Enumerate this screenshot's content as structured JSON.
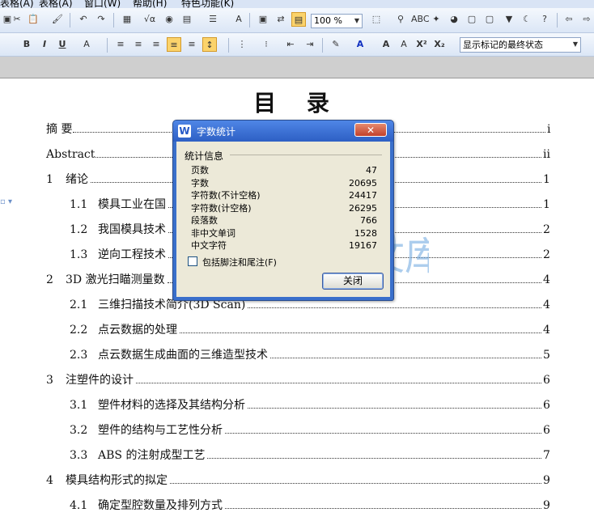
{
  "menu": [
    "表格(A)",
    "窗口(W)",
    "帮助(H)",
    "特色功能(K)"
  ],
  "toolbar1": {
    "zoom": "100 %",
    "icons": [
      "paste-icon",
      "format-painter-icon",
      "undo-icon",
      "redo-icon",
      "table-icon",
      "formula-icon",
      "chart-icon",
      "columns-icon",
      "find-icon",
      "spellcheck-icon",
      "help-icon",
      "back-icon"
    ]
  },
  "toolbar2": {
    "bold": "B",
    "italic": "I",
    "underline": "U",
    "markup_state": "显示标记的最终状态"
  },
  "document": {
    "title": "目 录",
    "entries": [
      {
        "num": "摘    要",
        "text": "",
        "page": "i",
        "level": 0
      },
      {
        "num": "Abstract",
        "text": "",
        "page": "ii",
        "level": 0
      },
      {
        "num": "1",
        "text": "绪论",
        "page": "1",
        "level": 1
      },
      {
        "num": "1.1",
        "text": "模具工业在国",
        "page": "1",
        "level": 2
      },
      {
        "num": "1.2",
        "text": "我国模具技术",
        "page": "2",
        "level": 2
      },
      {
        "num": "1.3",
        "text": "逆向工程技术",
        "page": "2",
        "level": 2
      },
      {
        "num": "2",
        "text": "3D 激光扫瞄测量数",
        "page": "4",
        "level": 1
      },
      {
        "num": "2.1",
        "text": "三维扫描技术简介(3D Scan)",
        "page": "4",
        "level": 2
      },
      {
        "num": "2.2",
        "text": "点云数据的处理",
        "page": "4",
        "level": 2
      },
      {
        "num": "2.3",
        "text": "点云数据生成曲面的三维造型技术",
        "page": "5",
        "level": 2
      },
      {
        "num": "3",
        "text": "注塑件的设计",
        "page": "6",
        "level": 1
      },
      {
        "num": "3.1",
        "text": "塑件材料的选择及其结构分析",
        "page": "6",
        "level": 2
      },
      {
        "num": "3.2",
        "text": "塑件的结构与工艺性分析",
        "page": "6",
        "level": 2
      },
      {
        "num": "3.3",
        "text": "ABS 的注射成型工艺",
        "page": "7",
        "level": 2
      },
      {
        "num": "4",
        "text": "模具结构形式的拟定",
        "page": "9",
        "level": 1
      },
      {
        "num": "4.1",
        "text": "确定型腔数量及排列方式",
        "page": "9",
        "level": 2
      }
    ]
  },
  "dialog": {
    "title": "字数统计",
    "group_label": "统计信息",
    "stats": [
      {
        "label": "页数",
        "value": "47"
      },
      {
        "label": "字数",
        "value": "20695"
      },
      {
        "label": "字符数(不计空格)",
        "value": "24417"
      },
      {
        "label": "字符数(计空格)",
        "value": "26295"
      },
      {
        "label": "段落数",
        "value": "766"
      },
      {
        "label": "非中文单词",
        "value": "1528"
      },
      {
        "label": "中文字符",
        "value": "19167"
      }
    ],
    "checkbox_label": "包括脚注和尾注(F)",
    "close_button": "关闭"
  },
  "watermark": "人人文库",
  "colors": {
    "dialog_title": "#2d5fc4",
    "dialog_body": "#ece9d8",
    "close_red": "#c2412b",
    "toolbar": "#dbe6f6"
  }
}
